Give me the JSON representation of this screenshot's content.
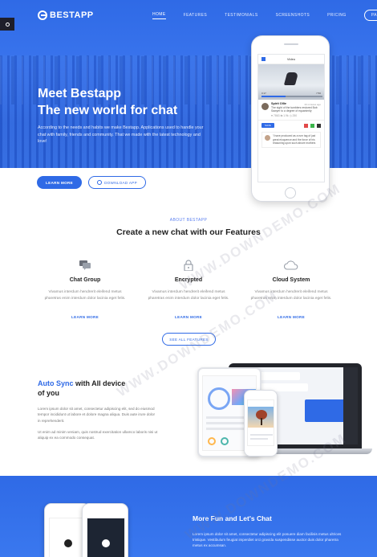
{
  "brand": {
    "name": "BESTAPP"
  },
  "nav": {
    "items": [
      "HOME",
      "FEATURES",
      "TESTIMONIALS",
      "SCREENSHOTS",
      "PRICING"
    ],
    "page_button": "PAGE"
  },
  "hero": {
    "title_line1": "Meet Bestapp",
    "title_line2": "The new world for chat",
    "text": "According to the needs and habits we make Bestapp. Applications used to handle your chat with family, friends and community. That we made with the latest technology and love!",
    "learn_more": "LEARN MORE",
    "download": "DOWNLOAD APP"
  },
  "phone_app": {
    "header": "Video",
    "video_time_start": "0:17",
    "video_time_end": "7:50",
    "post_name": "Spirit Ollie",
    "post_time": "20 minutes ago",
    "post_text": "The sight of the tumblers restored Bob Sawyer to a degree of equanimity",
    "post_stats": "♥ 7863   ⇆ 1.9k   ◷ 250",
    "save_label": "SAVE",
    "reply_text": "'I have produced as a rum tag of just great eloquence and the force of his reasoning upon such above mothers"
  },
  "about": {
    "kicker": "ABOUT BESTAPP",
    "title": "Create a new chat with our Features",
    "features": [
      {
        "icon": "chat-icon",
        "title": "Chat Group",
        "text": "Vivamus interdum hendrerit eleifend metus pharetras enim interdum dolor lacinia eget felis.",
        "link": "LEARN MORE"
      },
      {
        "icon": "lock-icon",
        "title": "Encrypted",
        "text": "Vivamus interdum hendrerit eleifend metus pharetras enim interdum dolor lacinia eget felis.",
        "link": "LEARN MORE"
      },
      {
        "icon": "cloud-icon",
        "title": "Cloud System",
        "text": "Vivamus interdum hendrerit eleifend metus pharetras enim interdum dolor lacinia eget felis.",
        "link": "LEARN MORE"
      }
    ],
    "see_all": "SEE ALL FEATURES"
  },
  "sync": {
    "title_highlight": "Auto Sync",
    "title_rest": " with All device",
    "title_line2": "of you",
    "p1": "Lorem ipsum dolor sit amet, consectetur adipiscing elit, sed do eiusmod tempor incididunt ut labore et dolore magna aliqua. Duis aute irure dolor in reprehenderit.",
    "p2": "Ut enim ad minim veniam, quis nostrud exercitation ullamco laboris nisi ut aliquip ex ea commodo consequat."
  },
  "fun": {
    "title": "More Fun and Let's Chat",
    "text": "Lorem ipsum dolor sit amet, consectetur adipiscing elit posuere diam facilisis metus ultrices tristique. Vestibulum feugiat imperdiet orci gravida suspendisse auctor duis dolor pharetra metus ex accumsan."
  },
  "watermark": "WWW.DOWNDEMO.COM",
  "colors": {
    "accent": "#2f6ae6",
    "hero_bg": "#3b76ee",
    "text_dark": "#222222",
    "text_muted": "#888888"
  }
}
